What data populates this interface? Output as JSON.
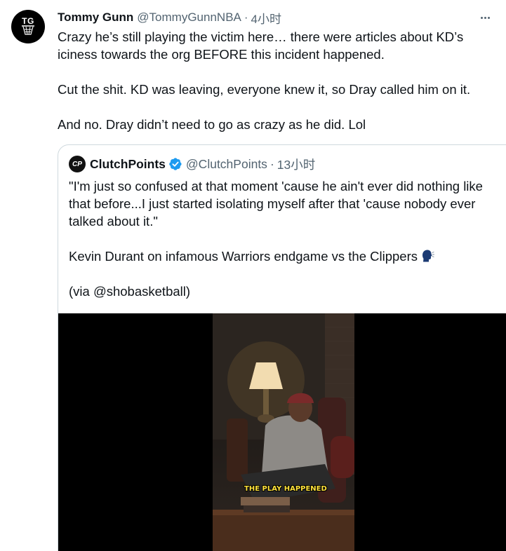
{
  "tweet": {
    "avatar_text": "TG",
    "display_name": "Tommy Gunn",
    "handle": "@TommyGunnNBA",
    "separator": "·",
    "time": "4小时",
    "paragraphs": [
      "Crazy he’s still playing the victim here… there were articles about KD’s iciness towards the org BEFORE this incident happened.",
      "Cut the shit. KD was leaving, everyone knew it, so Dray called him on it.",
      "And no. Dray didn’t need to go as crazy as he did. Lol"
    ]
  },
  "quote": {
    "avatar_text": "CP",
    "display_name": "ClutchPoints",
    "handle": "@ClutchPoints",
    "separator": "·",
    "time": "13小时",
    "paragraphs": [
      "\"I'm just so confused at that moment 'cause he ain't ever did nothing like that before...I just started isolating myself after that 'cause nobody ever talked about it.\"",
      "Kevin Durant on infamous Warriors endgame vs the Clippers",
      "(via @shobasketball)"
    ],
    "emoji_icon": "speaking-head-icon",
    "video_caption": "THE PLAY HAPPENED"
  },
  "colors": {
    "text": "#0f1419",
    "secondary": "#536471",
    "border": "#cfd9de",
    "verified": "#1d9bf0",
    "caption": "#ffe23a"
  }
}
